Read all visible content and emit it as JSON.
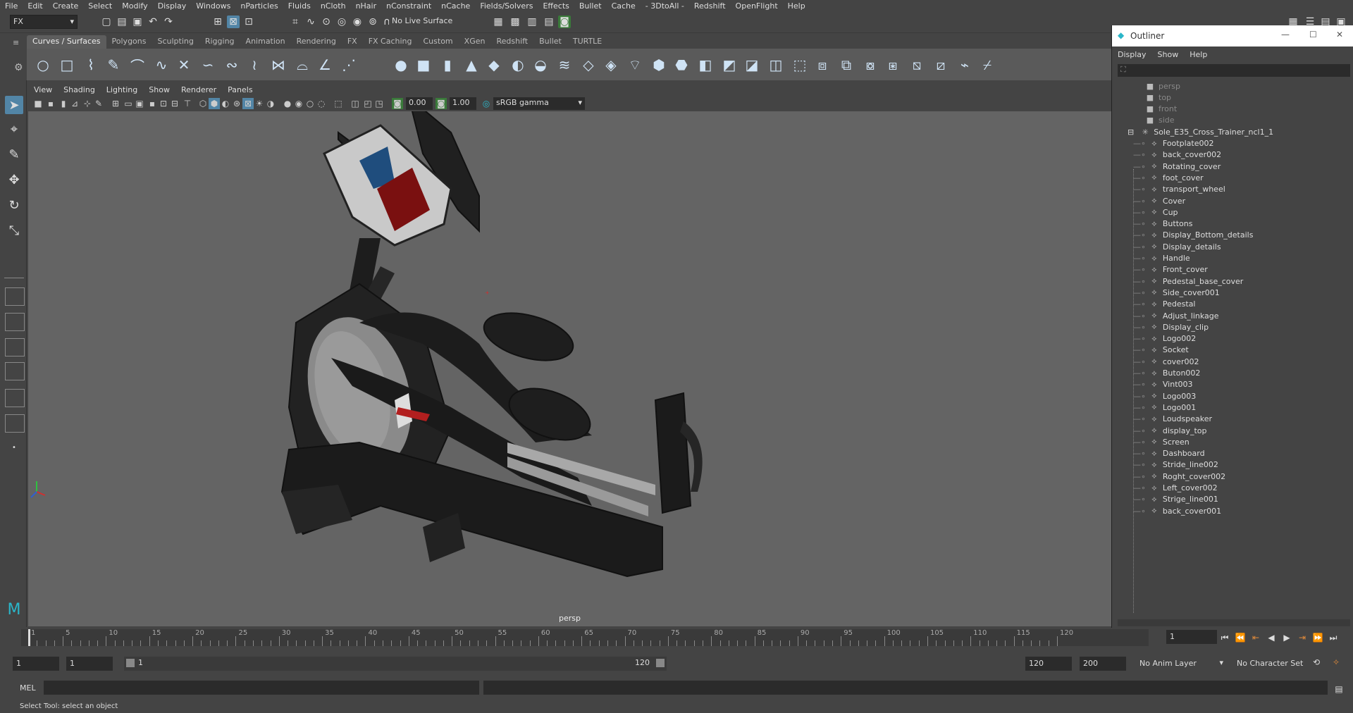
{
  "menubar": [
    "File",
    "Edit",
    "Create",
    "Select",
    "Modify",
    "Display",
    "Windows",
    "nParticles",
    "Fluids",
    "nCloth",
    "nHair",
    "nConstraint",
    "nCache",
    "Fields/Solvers",
    "Effects",
    "Bullet",
    "Cache",
    "- 3DtoAll -",
    "Redshift",
    "OpenFlight",
    "Help"
  ],
  "status": {
    "menuset": "FX",
    "live_surface": "No Live Surface"
  },
  "shelf_tabs": [
    "Curves / Surfaces",
    "Polygons",
    "Sculpting",
    "Rigging",
    "Animation",
    "Rendering",
    "FX",
    "FX Caching",
    "Custom",
    "XGen",
    "Redshift",
    "Bullet",
    "TURTLE"
  ],
  "viewport": {
    "menu": [
      "View",
      "Shading",
      "Lighting",
      "Show",
      "Renderer",
      "Panels"
    ],
    "exposure": "0.00",
    "gamma": "1.00",
    "color_space": "sRGB gamma",
    "camera_label": "persp"
  },
  "outliner": {
    "title": "Outliner",
    "menu": [
      "Display",
      "Show",
      "Help"
    ],
    "cameras": [
      "persp",
      "top",
      "front",
      "side"
    ],
    "group": "Sole_E35_Cross_Trainer_ncl1_1",
    "children": [
      "Footplate002",
      "back_cover002",
      "Rotating_cover",
      "foot_cover",
      "transport_wheel",
      "Cover",
      "Cup",
      "Buttons",
      "Display_Bottom_details",
      "Display_details",
      "Handle",
      "Front_cover",
      "Pedestal_base_cover",
      "Side_cover001",
      "Pedestal",
      "Adjust_linkage",
      "Display_clip",
      "Logo002",
      "Socket",
      "cover002",
      "Buton002",
      "Vint003",
      "Logo003",
      "Logo001",
      "Loudspeaker",
      "display_top",
      "Screen",
      "Dashboard",
      "Stride_line002",
      "Roght_cover002",
      "Left_cover002",
      "Strige_line001",
      "back_cover001"
    ]
  },
  "timeline": {
    "ticks": [
      "1",
      "5",
      "10",
      "15",
      "20",
      "25",
      "30",
      "35",
      "40",
      "45",
      "50",
      "55",
      "60",
      "65",
      "70",
      "75",
      "80",
      "85",
      "90",
      "95",
      "100",
      "105",
      "110",
      "115",
      "120"
    ],
    "current_frame": "1"
  },
  "range": {
    "start": "1",
    "start_inner": "1",
    "slider_start": "1",
    "slider_end": "120",
    "end_inner": "120",
    "end": "200",
    "anim_layer": "No Anim Layer",
    "character_set": "No Character Set"
  },
  "cmd": {
    "label": "MEL"
  },
  "helpline": "Select Tool: select an object",
  "colors": {
    "viewport_bg": "#646464",
    "accent": "#5285a6"
  }
}
